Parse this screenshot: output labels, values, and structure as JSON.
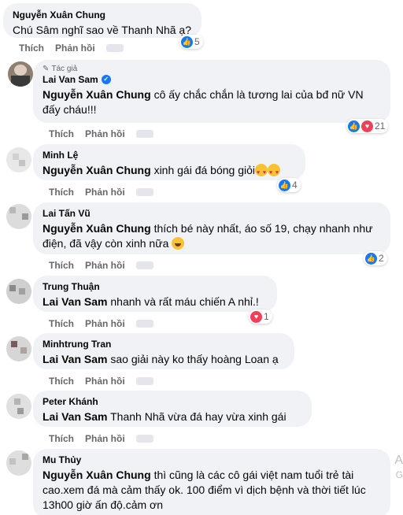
{
  "colors": {
    "bubble": "#f0f2f5",
    "like": "#1877f2",
    "love": "#f33e58",
    "meta": "#65676b"
  },
  "labels": {
    "like": "Thích",
    "reply": "Phản hồi",
    "author_tag": "Tác giả"
  },
  "comments": [
    {
      "author": "Nguyễn Xuân Chung",
      "mention": "",
      "text": "Chú Sâm nghĩ sao về Thanh Nhã ạ?",
      "reactions": [
        "like"
      ],
      "count": "5"
    },
    {
      "author": "Lai Van Sam",
      "verified": true,
      "author_tag": true,
      "mention": "Nguyễn Xuân Chung",
      "text": "cô ấy chắc chắn là tương lai của bđ nữ VN đấy cháu!!!",
      "reactions": [
        "like",
        "love"
      ],
      "count": "21"
    },
    {
      "author": "Minh Lệ",
      "mention": "Nguyễn Xuân Chung",
      "text": "xinh gái đá bóng giỏi",
      "emoji": "heart-eyes x2",
      "reactions": [
        "like"
      ],
      "count": "4"
    },
    {
      "author": "Lai Tấn Vũ",
      "mention": "Nguyễn Xuân Chung",
      "text": "thích bé này nhất, áo số 19, chạy nhanh như điện, đã vậy còn xinh nữa",
      "emoji": "smile",
      "reactions": [
        "like"
      ],
      "count": "2"
    },
    {
      "author": "Trung Thuận",
      "mention": "Lai Van Sam",
      "text": "nhanh và rất máu chiến A nhỉ.!",
      "reactions": [
        "love"
      ],
      "count": "1"
    },
    {
      "author": "Minhtrung Tran",
      "mention": "Lai Van Sam",
      "text": "sao giải này ko thấy hoàng Loan ạ",
      "reactions": [],
      "count": ""
    },
    {
      "author": "Peter Khánh",
      "mention": "Lai Van Sam",
      "text": "Thanh Nhã vừa đá hay vừa xinh gái",
      "reactions": [],
      "count": ""
    },
    {
      "author": "Mu Thủy",
      "mention": "Nguyễn Xuân Chung",
      "text": "thì cũng là các cô gái việt nam tuổi trẻ tài cao.xem đá mà cảm thấy ok. 100 điểm vì dịch bệnh và thời tiết lúc 13h00 giờ ấn độ.cảm ơn",
      "reactions": [],
      "count": ""
    }
  ],
  "edge_text": {
    "a": "A",
    "g": "G"
  }
}
